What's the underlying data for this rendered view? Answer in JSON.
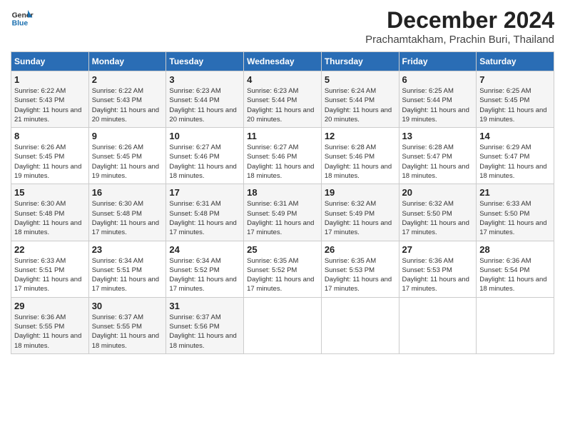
{
  "header": {
    "logo_line1": "General",
    "logo_line2": "Blue",
    "title": "December 2024",
    "subtitle": "Prachamtakham, Prachin Buri, Thailand"
  },
  "days_of_week": [
    "Sunday",
    "Monday",
    "Tuesday",
    "Wednesday",
    "Thursday",
    "Friday",
    "Saturday"
  ],
  "weeks": [
    [
      {
        "day": "1",
        "text": "Sunrise: 6:22 AM\nSunset: 5:43 PM\nDaylight: 11 hours and 21 minutes."
      },
      {
        "day": "2",
        "text": "Sunrise: 6:22 AM\nSunset: 5:43 PM\nDaylight: 11 hours and 20 minutes."
      },
      {
        "day": "3",
        "text": "Sunrise: 6:23 AM\nSunset: 5:44 PM\nDaylight: 11 hours and 20 minutes."
      },
      {
        "day": "4",
        "text": "Sunrise: 6:23 AM\nSunset: 5:44 PM\nDaylight: 11 hours and 20 minutes."
      },
      {
        "day": "5",
        "text": "Sunrise: 6:24 AM\nSunset: 5:44 PM\nDaylight: 11 hours and 20 minutes."
      },
      {
        "day": "6",
        "text": "Sunrise: 6:25 AM\nSunset: 5:44 PM\nDaylight: 11 hours and 19 minutes."
      },
      {
        "day": "7",
        "text": "Sunrise: 6:25 AM\nSunset: 5:45 PM\nDaylight: 11 hours and 19 minutes."
      }
    ],
    [
      {
        "day": "8",
        "text": "Sunrise: 6:26 AM\nSunset: 5:45 PM\nDaylight: 11 hours and 19 minutes."
      },
      {
        "day": "9",
        "text": "Sunrise: 6:26 AM\nSunset: 5:45 PM\nDaylight: 11 hours and 19 minutes."
      },
      {
        "day": "10",
        "text": "Sunrise: 6:27 AM\nSunset: 5:46 PM\nDaylight: 11 hours and 18 minutes."
      },
      {
        "day": "11",
        "text": "Sunrise: 6:27 AM\nSunset: 5:46 PM\nDaylight: 11 hours and 18 minutes."
      },
      {
        "day": "12",
        "text": "Sunrise: 6:28 AM\nSunset: 5:46 PM\nDaylight: 11 hours and 18 minutes."
      },
      {
        "day": "13",
        "text": "Sunrise: 6:28 AM\nSunset: 5:47 PM\nDaylight: 11 hours and 18 minutes."
      },
      {
        "day": "14",
        "text": "Sunrise: 6:29 AM\nSunset: 5:47 PM\nDaylight: 11 hours and 18 minutes."
      }
    ],
    [
      {
        "day": "15",
        "text": "Sunrise: 6:30 AM\nSunset: 5:48 PM\nDaylight: 11 hours and 18 minutes."
      },
      {
        "day": "16",
        "text": "Sunrise: 6:30 AM\nSunset: 5:48 PM\nDaylight: 11 hours and 17 minutes."
      },
      {
        "day": "17",
        "text": "Sunrise: 6:31 AM\nSunset: 5:48 PM\nDaylight: 11 hours and 17 minutes."
      },
      {
        "day": "18",
        "text": "Sunrise: 6:31 AM\nSunset: 5:49 PM\nDaylight: 11 hours and 17 minutes."
      },
      {
        "day": "19",
        "text": "Sunrise: 6:32 AM\nSunset: 5:49 PM\nDaylight: 11 hours and 17 minutes."
      },
      {
        "day": "20",
        "text": "Sunrise: 6:32 AM\nSunset: 5:50 PM\nDaylight: 11 hours and 17 minutes."
      },
      {
        "day": "21",
        "text": "Sunrise: 6:33 AM\nSunset: 5:50 PM\nDaylight: 11 hours and 17 minutes."
      }
    ],
    [
      {
        "day": "22",
        "text": "Sunrise: 6:33 AM\nSunset: 5:51 PM\nDaylight: 11 hours and 17 minutes."
      },
      {
        "day": "23",
        "text": "Sunrise: 6:34 AM\nSunset: 5:51 PM\nDaylight: 11 hours and 17 minutes."
      },
      {
        "day": "24",
        "text": "Sunrise: 6:34 AM\nSunset: 5:52 PM\nDaylight: 11 hours and 17 minutes."
      },
      {
        "day": "25",
        "text": "Sunrise: 6:35 AM\nSunset: 5:52 PM\nDaylight: 11 hours and 17 minutes."
      },
      {
        "day": "26",
        "text": "Sunrise: 6:35 AM\nSunset: 5:53 PM\nDaylight: 11 hours and 17 minutes."
      },
      {
        "day": "27",
        "text": "Sunrise: 6:36 AM\nSunset: 5:53 PM\nDaylight: 11 hours and 17 minutes."
      },
      {
        "day": "28",
        "text": "Sunrise: 6:36 AM\nSunset: 5:54 PM\nDaylight: 11 hours and 18 minutes."
      }
    ],
    [
      {
        "day": "29",
        "text": "Sunrise: 6:36 AM\nSunset: 5:55 PM\nDaylight: 11 hours and 18 minutes."
      },
      {
        "day": "30",
        "text": "Sunrise: 6:37 AM\nSunset: 5:55 PM\nDaylight: 11 hours and 18 minutes."
      },
      {
        "day": "31",
        "text": "Sunrise: 6:37 AM\nSunset: 5:56 PM\nDaylight: 11 hours and 18 minutes."
      },
      null,
      null,
      null,
      null
    ]
  ]
}
